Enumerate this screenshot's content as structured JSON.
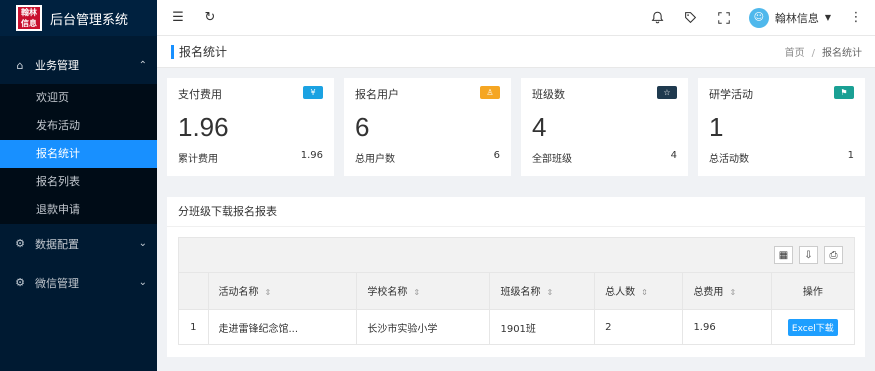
{
  "app": {
    "logo_text": "翰林信息",
    "title": "后台管理系统"
  },
  "sidebar": {
    "groups": [
      {
        "label": "业务管理",
        "icon": "home-icon",
        "expanded": true,
        "items": [
          {
            "label": "欢迎页"
          },
          {
            "label": "发布活动"
          },
          {
            "label": "报名统计",
            "active": true
          },
          {
            "label": "报名列表"
          },
          {
            "label": "退款申请"
          }
        ]
      },
      {
        "label": "数据配置",
        "icon": "gear-icon",
        "expanded": false
      },
      {
        "label": "微信管理",
        "icon": "gear-icon",
        "expanded": false
      }
    ]
  },
  "topbar": {
    "user_name": "翰林信息",
    "icons": [
      "menu-fold-icon",
      "refresh-icon",
      "bell-icon",
      "tag-icon",
      "fullscreen-icon",
      "more-icon"
    ]
  },
  "page": {
    "title": "报名统计",
    "breadcrumb": [
      "首页",
      "报名统计"
    ]
  },
  "cards": [
    {
      "title": "支付费用",
      "badge": "¥",
      "badge_color": "#1ba2e2",
      "value": "1.96",
      "foot_label": "累计费用",
      "foot_value": "1.96"
    },
    {
      "title": "报名用户",
      "badge": "♙",
      "badge_color": "#f5a623",
      "value": "6",
      "foot_label": "总用户数",
      "foot_value": "6"
    },
    {
      "title": "班级数",
      "badge": "☆",
      "badge_color": "#1f3a4f",
      "value": "4",
      "foot_label": "全部班级",
      "foot_value": "4"
    },
    {
      "title": "研学活动",
      "badge": "⚑",
      "badge_color": "#1aa094",
      "value": "1",
      "foot_label": "总活动数",
      "foot_value": "1"
    }
  ],
  "report": {
    "title": "分班级下载报名报表",
    "columns": [
      "",
      "活动名称",
      "学校名称",
      "班级名称",
      "总人数",
      "总费用",
      "操作"
    ],
    "rows": [
      {
        "index": "1",
        "activity": "走进雷锋纪念馆...",
        "school": "长沙市实验小学",
        "class": "1901班",
        "count": "2",
        "fee": "1.96",
        "action": "Excel下载"
      }
    ]
  }
}
